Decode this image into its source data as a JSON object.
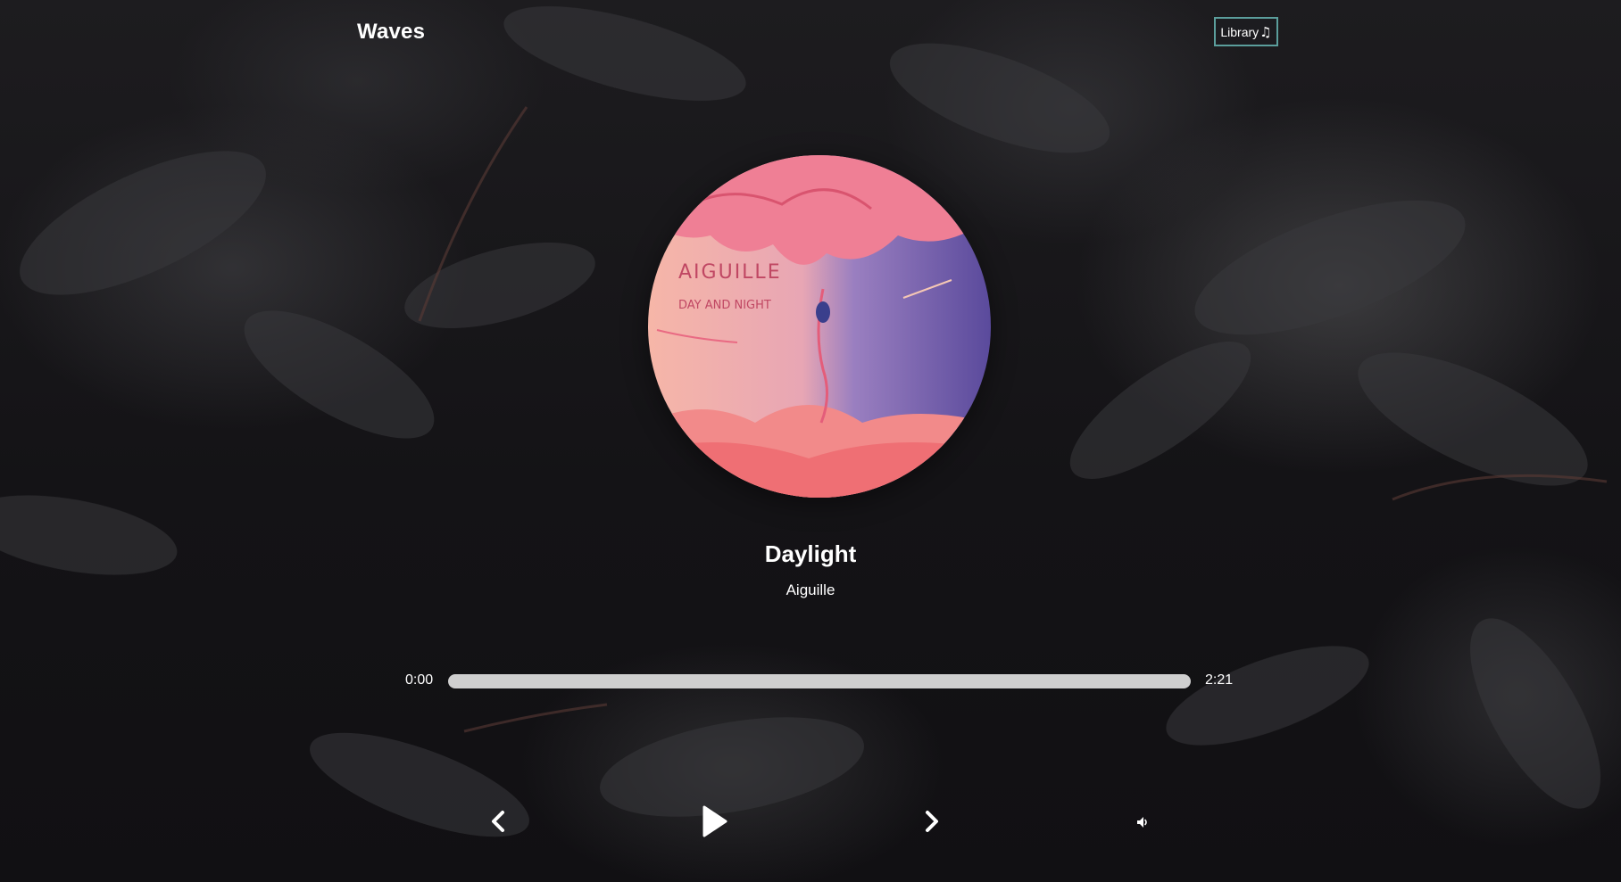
{
  "app": {
    "title": "Waves"
  },
  "nav": {
    "library_label": "Library",
    "library_icon": "music-note-icon"
  },
  "track": {
    "title": "Daylight",
    "artist": "Aiguille",
    "cover_text_artist": "AIGUILLE",
    "cover_text_album": "DAY AND NIGHT"
  },
  "player": {
    "current_time": "0:00",
    "total_time": "2:21",
    "progress_fraction": 0,
    "controls": {
      "previous_icon": "chevron-left-icon",
      "play_icon": "play-icon",
      "next_icon": "chevron-right-icon",
      "volume_icon": "volume-icon"
    }
  },
  "colors": {
    "accent_border": "#5b9e9c",
    "progress_track": "#cfcfcf",
    "text": "#ffffff",
    "background": "#151417"
  }
}
